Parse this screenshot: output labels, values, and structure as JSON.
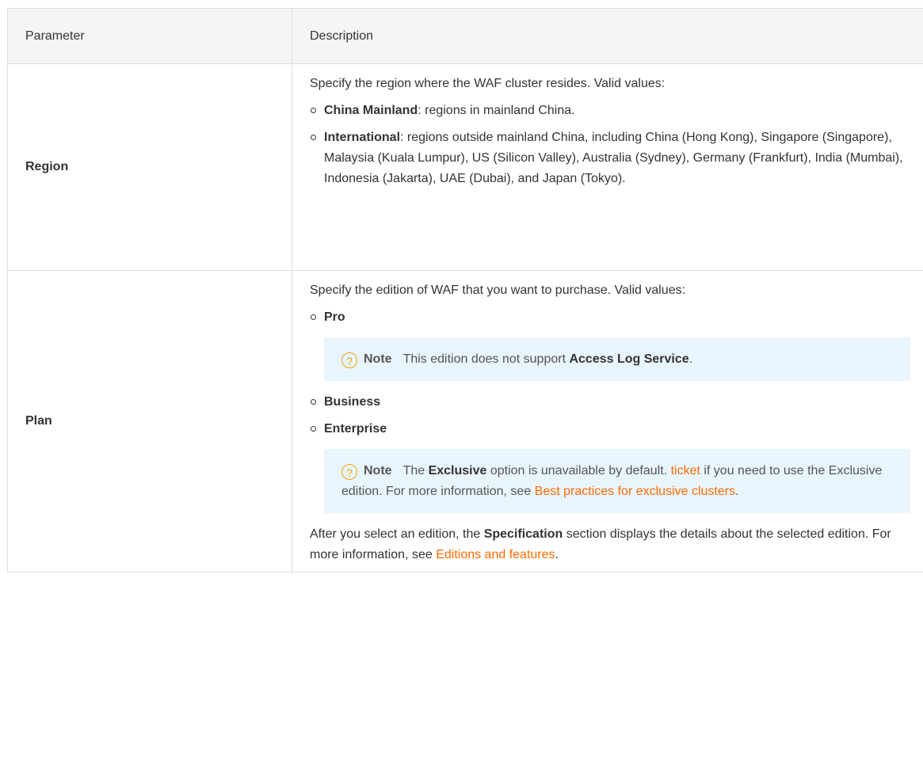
{
  "table": {
    "headers": [
      "Parameter",
      "Description"
    ],
    "region": {
      "name": "Region",
      "intro": "Specify the region where the WAF cluster resides. Valid values:",
      "options": [
        {
          "term": "China Mainland",
          "text": ": regions in mainland China."
        },
        {
          "term": "International",
          "text": ": regions outside mainland China, including China (Hong Kong), Singapore (Singapore), Malaysia (Kuala Lumpur), US (Silicon Valley), Australia (Sydney), Germany (Frankfurt), India (Mumbai), Indonesia (Jakarta), UAE (Dubai), and Japan (Tokyo)."
        }
      ]
    },
    "plan": {
      "name": "Plan",
      "intro": "Specify the edition of WAF that you want to purchase. Valid values:",
      "options": [
        "Pro",
        "Business",
        "Enterprise"
      ],
      "note1": {
        "icon": "question-circle-icon",
        "label": "Note",
        "text": "This edition does not support ",
        "term": "Access Log Service",
        "end": "."
      },
      "note2": {
        "icon": "question-circle-icon",
        "label": "Note",
        "text_a": "The ",
        "term": "Exclusive",
        "text_b": " option is unavailable by default. ",
        "link1": "ticket",
        "text_c": " if you need to use the Exclusive edition. For more information, see ",
        "link2": "Best practices for exclusive clusters",
        "end": "."
      },
      "outro": {
        "text_a": "After you select an edition, the ",
        "term": "Specification",
        "text_b": " section displays the details about the selected edition. For more information, see ",
        "link": "Editions and features",
        "end": "."
      }
    }
  },
  "colors": {
    "link": "#ff6a00",
    "note_bg": "#e9f5fc",
    "note_icon": "#f0a30a",
    "header_bg": "#f5f5f5",
    "border": "#dddddd"
  }
}
